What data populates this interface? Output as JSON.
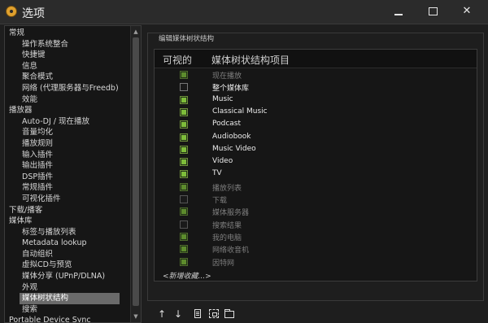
{
  "window": {
    "title": "选项",
    "icon": "app-logo-icon"
  },
  "tree": {
    "items": [
      {
        "label": "常规",
        "level": 0
      },
      {
        "label": "操作系统整合",
        "level": 1
      },
      {
        "label": "快捷键",
        "level": 1
      },
      {
        "label": "信息",
        "level": 1
      },
      {
        "label": "聚合模式",
        "level": 1
      },
      {
        "label": "网络 (代理服务器与Freedb)",
        "level": 1
      },
      {
        "label": "效能",
        "level": 1
      },
      {
        "label": "播放器",
        "level": 0
      },
      {
        "label": "Auto-DJ / 现在播放",
        "level": 1
      },
      {
        "label": "音量均化",
        "level": 1
      },
      {
        "label": "播放规则",
        "level": 1
      },
      {
        "label": "输入插件",
        "level": 1
      },
      {
        "label": "输出插件",
        "level": 1
      },
      {
        "label": "DSP插件",
        "level": 1
      },
      {
        "label": "常规插件",
        "level": 1
      },
      {
        "label": "可视化插件",
        "level": 1
      },
      {
        "label": "下载/播客",
        "level": 0
      },
      {
        "label": "媒体库",
        "level": 0
      },
      {
        "label": "标签与播放列表",
        "level": 1
      },
      {
        "label": "Metadata lookup",
        "level": 1
      },
      {
        "label": "自动组织",
        "level": 1
      },
      {
        "label": "虚拟CD与预览",
        "level": 1
      },
      {
        "label": "媒体分享 (UPnP/DLNA)",
        "level": 1
      },
      {
        "label": "外观",
        "level": 1
      },
      {
        "label": "媒体树状结构",
        "level": 1,
        "selected": true
      },
      {
        "label": "搜索",
        "level": 1
      },
      {
        "label": "Portable Device Sync",
        "level": 0
      }
    ]
  },
  "panel": {
    "group_title": "编辑媒体树状结构",
    "columns": {
      "visible": "可视的",
      "node": "媒体树状结构项目"
    },
    "rows": [
      {
        "label": "现在播放",
        "checked": true,
        "dim": true
      },
      {
        "label": "整个媒体库",
        "checked": false,
        "dim": false
      },
      {
        "label": "Music",
        "checked": true,
        "dim": false
      },
      {
        "label": "Classical Music",
        "checked": true,
        "dim": false
      },
      {
        "label": "Podcast",
        "checked": true,
        "dim": false
      },
      {
        "label": "Audiobook",
        "checked": true,
        "dim": false
      },
      {
        "label": "Music Video",
        "checked": true,
        "dim": false
      },
      {
        "label": "Video",
        "checked": true,
        "dim": false
      },
      {
        "label": "TV",
        "checked": true,
        "dim": false
      },
      {
        "label": "播放列表",
        "checked": true,
        "dim": true
      },
      {
        "label": "下载",
        "checked": false,
        "dim": true
      },
      {
        "label": "媒体服务器",
        "checked": true,
        "dim": true
      },
      {
        "label": "搜索结果",
        "checked": false,
        "dim": true
      },
      {
        "label": "我的电脑",
        "checked": true,
        "dim": true
      },
      {
        "label": "网络收音机",
        "checked": true,
        "dim": true
      },
      {
        "label": "因特网",
        "checked": true,
        "dim": true
      }
    ],
    "new_collection": "<新增收藏...>"
  },
  "toolbar": {
    "up": "↑",
    "down": "↓",
    "icons": [
      "move-up-icon",
      "move-down-icon",
      "document-icon",
      "scan-icon",
      "folder-icon"
    ]
  },
  "colors": {
    "check_on": "#7ebd3a",
    "selection": "#6a6a6a",
    "background": "#1e1e1e"
  }
}
